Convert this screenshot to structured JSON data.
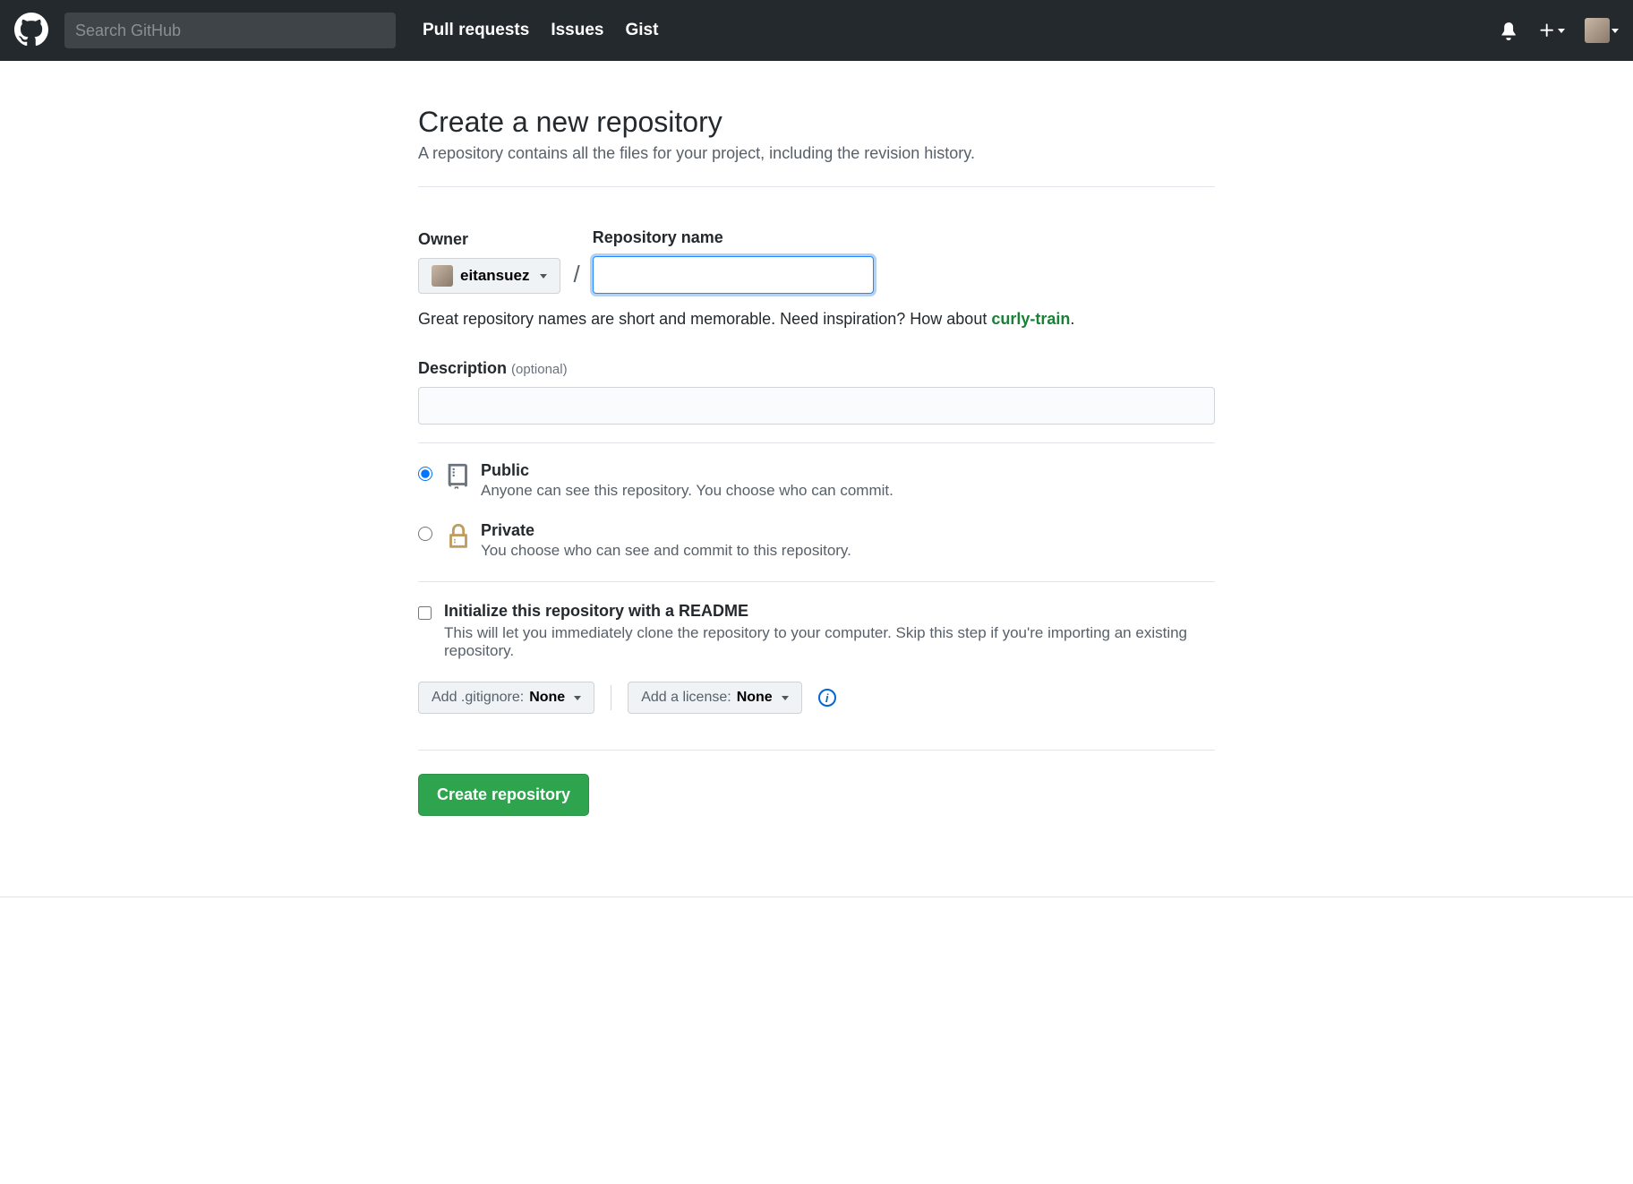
{
  "header": {
    "search_placeholder": "Search GitHub",
    "nav": {
      "pulls": "Pull requests",
      "issues": "Issues",
      "gist": "Gist"
    }
  },
  "page": {
    "title": "Create a new repository",
    "subtitle": "A repository contains all the files for your project, including the revision history."
  },
  "owner": {
    "label": "Owner",
    "username": "eitansuez"
  },
  "repo": {
    "label": "Repository name",
    "value": "",
    "hint_prefix": "Great repository names are short and memorable. Need inspiration? How about ",
    "suggestion": "curly-train",
    "hint_suffix": "."
  },
  "description": {
    "label": "Description",
    "optional_text": "(optional)",
    "value": ""
  },
  "visibility": {
    "public": {
      "title": "Public",
      "sub": "Anyone can see this repository. You choose who can commit."
    },
    "private": {
      "title": "Private",
      "sub": "You choose who can see and commit to this repository."
    }
  },
  "init": {
    "title": "Initialize this repository with a README",
    "sub": "This will let you immediately clone the repository to your computer. Skip this step if you're importing an existing repository."
  },
  "dropdowns": {
    "gitignore_label": "Add .gitignore:",
    "gitignore_value": "None",
    "license_label": "Add a license:",
    "license_value": "None"
  },
  "submit": {
    "label": "Create repository"
  }
}
